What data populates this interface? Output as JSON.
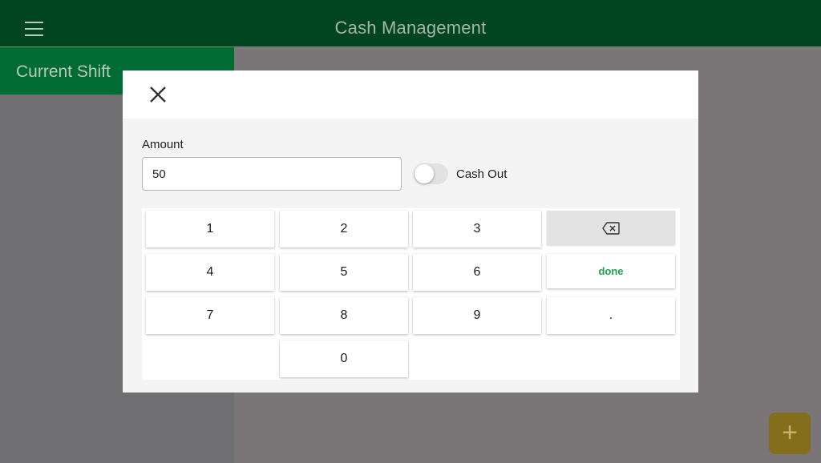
{
  "header": {
    "title": "Cash Management",
    "menu_icon": "hamburger-menu-icon"
  },
  "sidebar": {
    "items": [
      {
        "label": "Current Shift",
        "selected": true
      }
    ]
  },
  "fab": {
    "symbol": "+",
    "icon": "plus-icon",
    "color": "#846d1b"
  },
  "dialog": {
    "close_icon": "close-icon",
    "amount_label": "Amount",
    "amount_value": "50",
    "toggle_label": "Cash Out",
    "toggle_on": false,
    "keypad": {
      "k1": "1",
      "k2": "2",
      "k3": "3",
      "k4": "4",
      "k5": "5",
      "k6": "6",
      "k7": "7",
      "k8": "8",
      "k9": "9",
      "k0": "0",
      "dot": ".",
      "done": "done",
      "backspace_icon": "backspace-icon"
    }
  },
  "colors": {
    "header": "#004420",
    "accent": "#006b32",
    "done_text": "#1fa14a"
  }
}
